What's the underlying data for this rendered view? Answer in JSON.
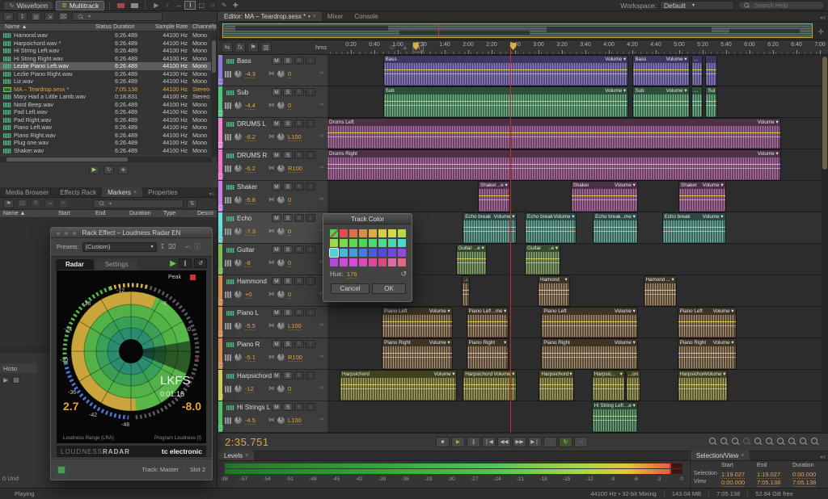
{
  "topbar": {
    "waveform": "Waveform",
    "multitrack": "Multitrack",
    "workspace_label": "Workspace:",
    "workspace_value": "Default",
    "search_placeholder": "Search Help",
    "tools": [
      "move-tool",
      "razor-tool",
      "slip-tool",
      "time-selection-tool",
      "marquee-tool",
      "lasso-tool",
      "paintbrush-tool",
      "spot-healing-tool"
    ]
  },
  "files": {
    "tab": "Files",
    "columns": [
      "Name",
      "Status",
      "Duration",
      "Sample Rate",
      "Channels"
    ],
    "rows": [
      {
        "name": "Hamond.wav",
        "status": "",
        "duration": "6:26.489",
        "rate": "44100 Hz",
        "channels": "Mono",
        "selected": false,
        "session": false
      },
      {
        "name": "Harpsichord.wav *",
        "status": "",
        "duration": "6:26.489",
        "rate": "44100 Hz",
        "channels": "Mono",
        "selected": false,
        "session": false
      },
      {
        "name": "Hi String Left.wav",
        "status": "",
        "duration": "6:26.489",
        "rate": "44100 Hz",
        "channels": "Mono",
        "selected": false,
        "session": false
      },
      {
        "name": "Hi String Right.wav",
        "status": "",
        "duration": "6:26.489",
        "rate": "44100 Hz",
        "channels": "Mono",
        "selected": false,
        "session": false
      },
      {
        "name": "Lezlie Piano Left.wav",
        "status": "",
        "duration": "6:26.489",
        "rate": "44100 Hz",
        "channels": "Mono",
        "selected": true,
        "session": false
      },
      {
        "name": "Lezlie Piano Right.wav",
        "status": "",
        "duration": "6:26.489",
        "rate": "44100 Hz",
        "channels": "Mono",
        "selected": false,
        "session": false
      },
      {
        "name": "Liz.wav",
        "status": "",
        "duration": "6:26.489",
        "rate": "44100 Hz",
        "channels": "Mono",
        "selected": false,
        "session": false
      },
      {
        "name": "MA – Teardrop.sesx *",
        "status": "",
        "duration": "7:05.138",
        "rate": "44100 Hz",
        "channels": "Stereo",
        "selected": false,
        "session": true
      },
      {
        "name": "Mary Had a Little Lamb.wav",
        "status": "",
        "duration": "0:18.831",
        "rate": "44100 Hz",
        "channels": "Stereo",
        "selected": false,
        "session": false
      },
      {
        "name": "Nord Beep.wav",
        "status": "",
        "duration": "6:26.489",
        "rate": "44100 Hz",
        "channels": "Mono",
        "selected": false,
        "session": false
      },
      {
        "name": "Pad Left.wav",
        "status": "",
        "duration": "6:26.489",
        "rate": "44100 Hz",
        "channels": "Mono",
        "selected": false,
        "session": false
      },
      {
        "name": "Pad Right.wav",
        "status": "",
        "duration": "6:26.489",
        "rate": "44100 Hz",
        "channels": "Mono",
        "selected": false,
        "session": false
      },
      {
        "name": "Piano Left.wav",
        "status": "",
        "duration": "6:26.489",
        "rate": "44100 Hz",
        "channels": "Mono",
        "selected": false,
        "session": false
      },
      {
        "name": "Piano Right.wav",
        "status": "",
        "duration": "6:26.489",
        "rate": "44100 Hz",
        "channels": "Mono",
        "selected": false,
        "session": false
      },
      {
        "name": "Plug one.wav",
        "status": "",
        "duration": "6:26.489",
        "rate": "44100 Hz",
        "channels": "Mono",
        "selected": false,
        "session": false
      },
      {
        "name": "Shaker.wav",
        "status": "",
        "duration": "6:26.489",
        "rate": "44100 Hz",
        "channels": "Mono",
        "selected": false,
        "session": false
      }
    ]
  },
  "panel_tabs": {
    "media_browser": "Media Browser",
    "effects_rack": "Effects Rack",
    "markers": "Markers",
    "properties": "Properties",
    "markers_columns": [
      "Name",
      "Start",
      "End",
      "Duration",
      "Type",
      "Descri"
    ]
  },
  "history": {
    "tab": "Histo",
    "undo": "0 Und"
  },
  "rack": {
    "title": "Rack Effect – Loudness Radar EN",
    "presets_label": "Presets:",
    "preset_value": "(Custom)",
    "tab_radar": "Radar",
    "tab_settings": "Settings",
    "peak": "Peak",
    "ring_labels": [
      "-12",
      "-18",
      "-24",
      "-30",
      "-36",
      "-42",
      "-48",
      "-6",
      "0",
      "6"
    ],
    "unit": "LKFS",
    "time": "0:01:16",
    "lra_value": "2.7",
    "loudness_value": "-8.0",
    "lra_caption": "Loudness Range (LRA)",
    "loudness_caption": "Program Loudness (I)",
    "brand_a": "LOUDNESS",
    "brand_b": "RADAR",
    "vendor": "tc electronic",
    "track": "Track: Master",
    "slot": "Slot 2"
  },
  "editor": {
    "tab": "Editor: MA – Teardrop.sesx *",
    "tab_mixer": "Mixer",
    "tab_console": "Console",
    "ruler_unit": "hms",
    "ticks": [
      "0:20",
      "0:40",
      "1:00",
      "1:20",
      "1:40",
      "2:00",
      "2:20",
      "2:40",
      "3:00",
      "3:20",
      "3:40",
      "4:00",
      "4:20",
      "4:40",
      "5:00",
      "5:20",
      "5:40",
      "6:00",
      "6:20",
      "6:40",
      "7:00"
    ],
    "markers_s": [
      75,
      158
    ],
    "playhead_s": 155.751
  },
  "tracks": [
    {
      "name": "Bass",
      "strip": "#8a7cd8",
      "vol": "-4.3",
      "pan": "0",
      "selected": false,
      "pal": {
        "head": "#3d3760",
        "body": "#534b7e",
        "wave": "#9a8fd0"
      },
      "clips": [
        {
          "label": "Bass",
          "vol": "Volume",
          "s": 48,
          "e": 256
        },
        {
          "label": "Bass",
          "vol": "Volume",
          "s": 261,
          "e": 308
        },
        {
          "label": "...",
          "s": 311,
          "e": 319
        },
        {
          "label": "",
          "s": 323,
          "e": 332
        }
      ]
    },
    {
      "name": "Sub",
      "strip": "#4ec87e",
      "vol": "-4.4",
      "pan": "0",
      "selected": false,
      "pal": {
        "head": "#2c4f3a",
        "body": "#3e6a50",
        "wave": "#84c9a0"
      },
      "clips": [
        {
          "label": "Sub",
          "vol": "Volume",
          "s": 48,
          "e": 256
        },
        {
          "label": "Sub",
          "vol": "Volume",
          "s": 261,
          "e": 308
        },
        {
          "label": "...",
          "s": 311,
          "e": 319
        },
        {
          "label": "Sub",
          "s": 323,
          "e": 332
        }
      ]
    },
    {
      "name": "DRUMS L",
      "strip": "#f086d2",
      "vol": "-6.2",
      "pan": "L100",
      "selected": false,
      "pal": {
        "head": "#4e2f48",
        "body": "#6b4263",
        "wave": "#c07fb4"
      },
      "clips": [
        {
          "label": "Drums Left",
          "vol": "Volume",
          "s": 0,
          "e": 386
        }
      ]
    },
    {
      "name": "DRUMS R",
      "strip": "#f073c8",
      "vol": "-6.2",
      "pan": "R100",
      "selected": false,
      "pal": {
        "head": "#4e2f48",
        "body": "#6b4263",
        "wave": "#c07fb4"
      },
      "clips": [
        {
          "label": "Drums Right",
          "vol": "Volume",
          "s": 0,
          "e": 386
        }
      ]
    },
    {
      "name": "Shaker",
      "strip": "#c880e8",
      "vol": "-5.8",
      "pan": "0",
      "selected": false,
      "pal": {
        "head": "#4e2f48",
        "body": "#6b4263",
        "wave": "#c07fb4"
      },
      "clips": [
        {
          "label": "Shaker",
          "vol": "...e",
          "s": 129,
          "e": 155
        },
        {
          "label": "Shaker",
          "vol": "Volume",
          "s": 208,
          "e": 264
        },
        {
          "label": "Shaker",
          "vol": "Volume",
          "s": 300,
          "e": 339
        }
      ]
    },
    {
      "name": "Echo",
      "strip": "#6ee0e0",
      "vol": "-7.3",
      "pan": "0",
      "selected": true,
      "pal": {
        "head": "#2b4a45",
        "body": "#3d665f",
        "wave": "#82c4b6"
      },
      "clips": [
        {
          "label": "Echo break",
          "vol": "Volume",
          "s": 116,
          "e": 161
        },
        {
          "label": "Echo break",
          "vol": "Volume",
          "s": 169,
          "e": 212
        },
        {
          "label": "Echo break",
          "vol": "...me",
          "s": 227,
          "e": 264
        },
        {
          "label": "Echo break",
          "vol": "Volume",
          "s": 286,
          "e": 339
        }
      ]
    },
    {
      "name": "Guitar",
      "strip": "#8cd45e",
      "vol": "-8",
      "pan": "0",
      "selected": false,
      "pal": {
        "head": "#39492f",
        "body": "#4d6340",
        "wave": "#9cba82"
      },
      "clips": [
        {
          "label": "Guitar",
          "vol": "..e",
          "s": 110,
          "e": 135
        },
        {
          "label": "Guitar",
          "vol": "..e",
          "s": 169,
          "e": 198
        }
      ]
    },
    {
      "name": "Hammond",
      "strip": "#f0a05a",
      "vol": "+0",
      "pan": "0",
      "selected": false,
      "pal": {
        "head": "#3e3425",
        "body": "#55483a",
        "wave": "#c9a878"
      },
      "clips": [
        {
          "label": "..d",
          "s": 115,
          "e": 121
        },
        {
          "label": "Hamond",
          "vol": "",
          "s": 180,
          "e": 206
        },
        {
          "label": "Hamond",
          "vol": "...",
          "s": 270,
          "e": 297
        }
      ]
    },
    {
      "name": "Piano L",
      "strip": "#f0a05a",
      "vol": "-5.5",
      "pan": "L100",
      "selected": false,
      "pal": {
        "head": "#3e3425",
        "body": "#55483a",
        "wave": "#c9a878"
      },
      "clips": [
        {
          "label": "Piano Left",
          "vol": "Volume",
          "s": 47,
          "e": 106
        },
        {
          "label": "Piano Left",
          "vol": "...me",
          "s": 119,
          "e": 154
        },
        {
          "label": "Piano Left",
          "vol": "Volume",
          "s": 183,
          "e": 264
        },
        {
          "label": "Piano Left",
          "vol": "Volume",
          "s": 299,
          "e": 348
        }
      ]
    },
    {
      "name": "Piano R",
      "strip": "#f0a05a",
      "vol": "-5.1",
      "pan": "R100",
      "selected": false,
      "pal": {
        "head": "#3e3425",
        "body": "#55483a",
        "wave": "#c9a878"
      },
      "clips": [
        {
          "label": "Piano Right",
          "vol": "Volume",
          "s": 47,
          "e": 106
        },
        {
          "label": "Piano Right",
          "vol": "",
          "s": 119,
          "e": 154
        },
        {
          "label": "Piano Right",
          "vol": "Volume",
          "s": 183,
          "e": 264
        },
        {
          "label": "Piano Right",
          "vol": "Volume",
          "s": 299,
          "e": 348
        }
      ]
    },
    {
      "name": "Harpsichord",
      "strip": "#e8e45e",
      "vol": "-12",
      "pan": "0",
      "selected": false,
      "pal": {
        "head": "#43421f",
        "body": "#5c5a30",
        "wave": "#bfbc7c"
      },
      "clips": [
        {
          "label": "Harpsichord",
          "vol": "Volume",
          "s": 11,
          "e": 110
        },
        {
          "label": "Harpsichord",
          "vol": "Volume",
          "s": 116,
          "e": 161
        },
        {
          "label": "Harpsichord",
          "vol": "",
          "s": 181,
          "e": 210
        },
        {
          "label": "Harpsic...",
          "vol": "",
          "s": 226,
          "e": 253
        },
        {
          "label": "...ord",
          "s": 255,
          "e": 266
        },
        {
          "label": "Harpsichord",
          "vol": "Volume",
          "s": 299,
          "e": 341
        }
      ]
    },
    {
      "name": "Hi Strings L",
      "strip": "#5ed86e",
      "vol": "-4.5",
      "pan": "L100",
      "selected": false,
      "pal": {
        "head": "#28452f",
        "body": "#3a5e42",
        "wave": "#86c292"
      },
      "clips": [
        {
          "label": "Hi String Left",
          "vol": "...e",
          "s": 226,
          "e": 264
        }
      ]
    }
  ],
  "dialog": {
    "title": "Track Color",
    "hue_label": "Hue:",
    "hue_value": "176",
    "cancel": "Cancel",
    "ok": "OK",
    "selected_index": 16,
    "swatches": [
      "none",
      "#d9534a",
      "#d9714a",
      "#d98f4a",
      "#d9ad4a",
      "#d9cb4a",
      "#d6d94a",
      "#b8d94a",
      "#9ad94a",
      "#7cd94a",
      "#5ed94a",
      "#4ad954",
      "#4ad972",
      "#4ad990",
      "#4ad9ae",
      "#4ad9cc",
      "#4ad4d9",
      "#4ab6d9",
      "#4a98d9",
      "#4a7ad9",
      "#4a5cd9",
      "#544ad9",
      "#724ad9",
      "#904ad9",
      "#ae4ad9",
      "#cc4ad9",
      "#d94ad4",
      "#d94ab6",
      "#d94a98",
      "#d94a7a",
      "#e06aa8",
      "#e06a84"
    ]
  },
  "transport": {
    "time": "2:35.751",
    "buttons": [
      "stop",
      "play",
      "pause",
      "skip-to-start",
      "rewind",
      "fast-forward",
      "skip-to-end",
      "record",
      "loop",
      "skip-selection"
    ]
  },
  "levels": {
    "tab": "Levels",
    "scale": [
      "dB",
      "-57",
      "-54",
      "-51",
      "-48",
      "-45",
      "-42",
      "-39",
      "-36",
      "-33",
      "-30",
      "-27",
      "-24",
      "-21",
      "-18",
      "-15",
      "-12",
      "-9",
      "-6",
      "-3",
      "0"
    ]
  },
  "selection_view": {
    "tab": "Selection/View",
    "columns": [
      "Start",
      "End",
      "Duration"
    ],
    "rows": [
      {
        "label": "Selection",
        "values": [
          "1:19.027",
          "1:19.027",
          "0:00.000"
        ]
      },
      {
        "label": "View",
        "values": [
          "0:00.000",
          "7:05.138",
          "7:05.138"
        ]
      }
    ]
  },
  "status": {
    "left": "Playing",
    "items": [
      "44100 Hz • 32-bit Mixing",
      "143.04 MB",
      "7:05.138",
      "52.84 GB free"
    ]
  }
}
